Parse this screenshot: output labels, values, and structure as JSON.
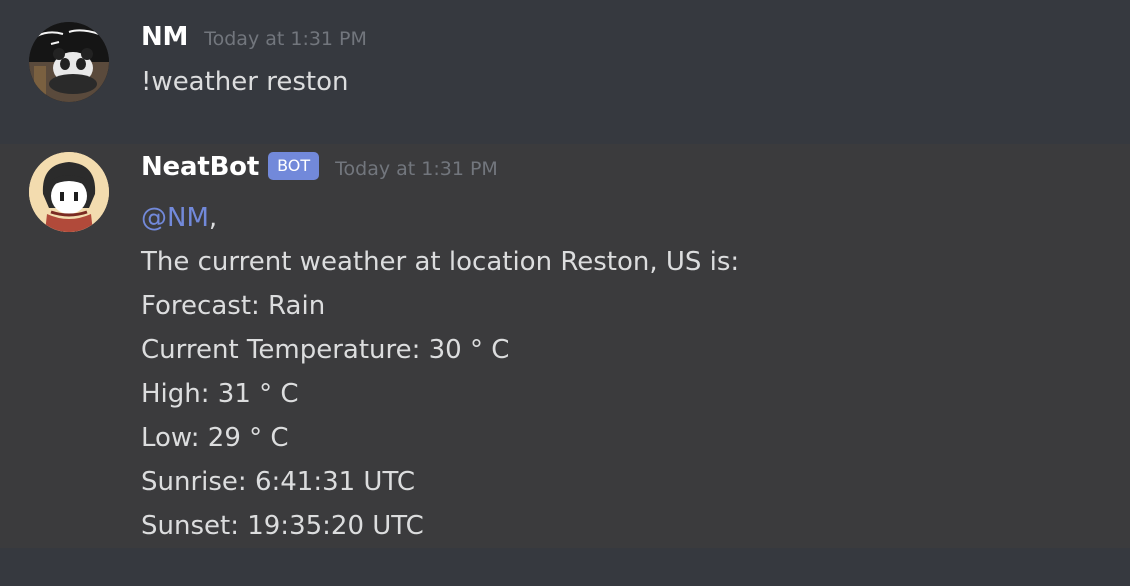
{
  "messages": [
    {
      "author": "NM",
      "timestamp": "Today at 1:31 PM",
      "text": "!weather reston"
    },
    {
      "author": "NeatBot",
      "badge": "BOT",
      "timestamp": "Today at 1:31 PM",
      "mention": "@NM",
      "mention_suffix": ",",
      "lines": [
        "The current weather at location Reston, US is:",
        "Forecast: Rain",
        "Current Temperature: 30 ° C",
        "High: 31 ° C",
        "Low: 29 ° C",
        "Sunrise: 6:41:31 UTC",
        "Sunset: 19:35:20 UTC"
      ]
    }
  ],
  "colors": {
    "background": "#36393f",
    "highlight_row": "#3b3b3d",
    "mention": "#7289da",
    "bot_badge": "#7289da",
    "timestamp": "#72767d",
    "text": "#dcddde"
  }
}
